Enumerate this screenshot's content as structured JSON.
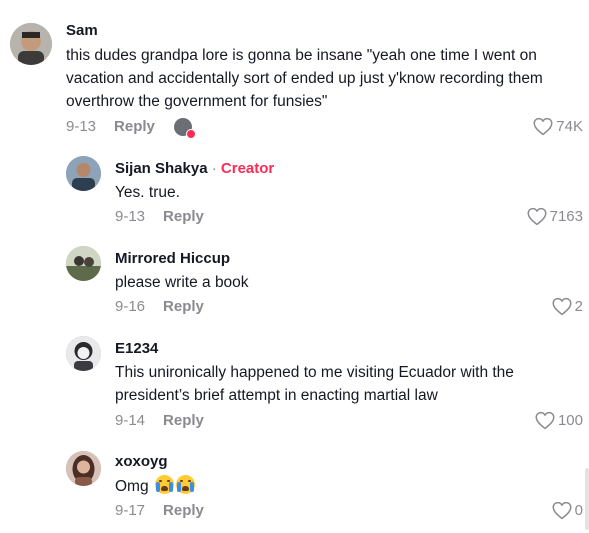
{
  "comments": [
    {
      "author": "Sam",
      "text": "this dudes grandpa lore is gonna be insane \"yeah one time I went on vacation and accidentally sort of ended up just y'know recording them overthrow the government for funsies\"",
      "date": "9-13",
      "reply": "Reply",
      "likes": "74K"
    },
    {
      "author": "Sijan Shakya",
      "separator": "·",
      "badge": "Creator",
      "text": "Yes. true.",
      "date": "9-13",
      "reply": "Reply",
      "likes": "7163"
    },
    {
      "author": "Mirrored Hiccup",
      "text": "please write a book",
      "date": "9-16",
      "reply": "Reply",
      "likes": "2"
    },
    {
      "author": "E1234",
      "text": "This unironically happened to me visiting Ecuador with the president’s brief attempt in enacting martial law",
      "date": "9-14",
      "reply": "Reply",
      "likes": "100"
    },
    {
      "author": "xoxoyg",
      "text": "Omg",
      "emoji": [
        "loudly-crying-face-emoji",
        "loudly-crying-face-emoji"
      ],
      "date": "9-17",
      "reply": "Reply",
      "likes": "0"
    }
  ],
  "icons": {
    "like": "heart-outline-icon",
    "creator_liked": "creator-liked-avatar-icon"
  },
  "colors": {
    "creator": "#fe2c55",
    "meta": "#8a8b91",
    "text": "#161823"
  }
}
